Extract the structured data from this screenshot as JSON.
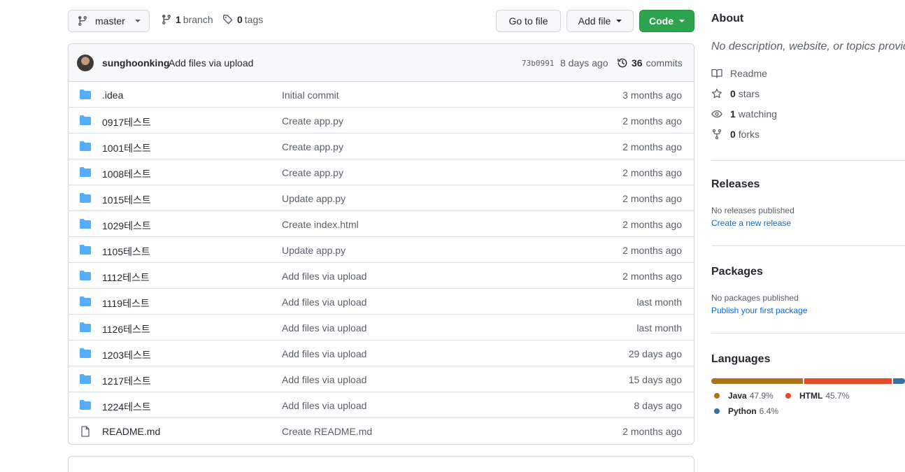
{
  "toolbar": {
    "branch_label": "master",
    "branch_count": "1",
    "branch_word": "branch",
    "tag_count": "0",
    "tag_word": "tags",
    "goto_label": "Go to file",
    "addfile_label": "Add file",
    "code_label": "Code"
  },
  "commit": {
    "author": "sunghoonking",
    "message": "Add files via upload",
    "sha": "73b0991",
    "age": "8 days ago",
    "count": "36",
    "count_word": "commits"
  },
  "files": [
    {
      "name": ".idea",
      "message": "Initial commit",
      "age": "3 months ago",
      "type": "dir"
    },
    {
      "name": "0917테스트",
      "message": "Create app.py",
      "age": "2 months ago",
      "type": "dir"
    },
    {
      "name": "1001테스트",
      "message": "Create app.py",
      "age": "2 months ago",
      "type": "dir"
    },
    {
      "name": "1008테스트",
      "message": "Create app.py",
      "age": "2 months ago",
      "type": "dir"
    },
    {
      "name": "1015테스트",
      "message": "Update app.py",
      "age": "2 months ago",
      "type": "dir"
    },
    {
      "name": "1029테스트",
      "message": "Create index.html",
      "age": "2 months ago",
      "type": "dir"
    },
    {
      "name": "1105테스트",
      "message": "Update app.py",
      "age": "2 months ago",
      "type": "dir"
    },
    {
      "name": "1112테스트",
      "message": "Add files via upload",
      "age": "2 months ago",
      "type": "dir"
    },
    {
      "name": "1119테스트",
      "message": "Add files via upload",
      "age": "last month",
      "type": "dir"
    },
    {
      "name": "1126테스트",
      "message": "Add files via upload",
      "age": "last month",
      "type": "dir"
    },
    {
      "name": "1203테스트",
      "message": "Add files via upload",
      "age": "29 days ago",
      "type": "dir"
    },
    {
      "name": "1217테스트",
      "message": "Add files via upload",
      "age": "15 days ago",
      "type": "dir"
    },
    {
      "name": "1224테스트",
      "message": "Add files via upload",
      "age": "8 days ago",
      "type": "dir"
    },
    {
      "name": "README.md",
      "message": "Create README.md",
      "age": "2 months ago",
      "type": "file"
    }
  ],
  "about": {
    "title": "About",
    "description": "No description, website, or topics provided.",
    "readme": "Readme",
    "stars_count": "0",
    "stars_word": "stars",
    "watching_count": "1",
    "watching_word": "watching",
    "forks_count": "0",
    "forks_word": "forks"
  },
  "releases": {
    "title": "Releases",
    "empty": "No releases published",
    "link": "Create a new release"
  },
  "packages": {
    "title": "Packages",
    "empty": "No packages published",
    "link": "Publish your first package"
  },
  "languages": {
    "title": "Languages",
    "items": [
      {
        "name": "Java",
        "percent": "47.9%",
        "value": 47.9,
        "color": "#b07219"
      },
      {
        "name": "HTML",
        "percent": "45.7%",
        "value": 45.7,
        "color": "#e34c26"
      },
      {
        "name": "Python",
        "percent": "6.4%",
        "value": 6.4,
        "color": "#3572A5"
      }
    ]
  },
  "colors": {
    "code_button": "#2da44e",
    "folder_icon": "#54aeff",
    "link": "#0969da"
  },
  "icons": [
    "git-branch-icon",
    "tag-icon",
    "history-icon",
    "folder-icon",
    "file-icon",
    "book-icon",
    "star-icon",
    "eye-icon",
    "repo-forked-icon"
  ]
}
